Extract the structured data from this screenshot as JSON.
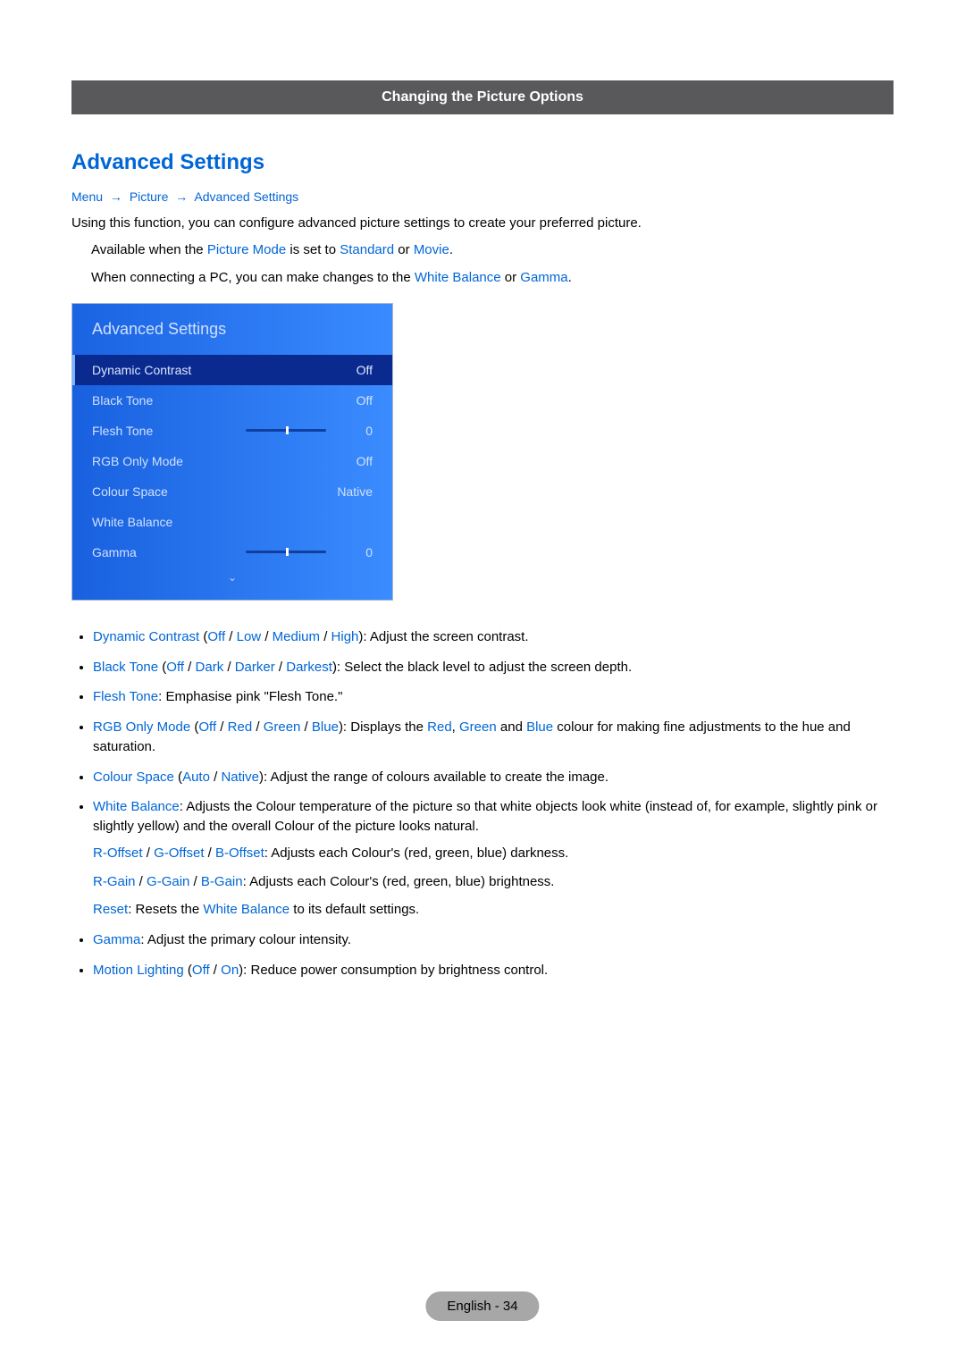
{
  "banner": "Changing the Picture Options",
  "heading": "Advanced Settings",
  "breadcrumb": {
    "a": "Menu",
    "b": "Picture",
    "c": "Advanced Settings"
  },
  "intro": "Using this function, you can configure advanced picture settings to create your preferred picture.",
  "note1_pre": "Available when the ",
  "note1_pm": "Picture Mode",
  "note1_mid": " is set to ",
  "note1_std": "Standard",
  "note1_or": " or ",
  "note1_mov": "Movie",
  "note1_end": ".",
  "note2_pre": "When connecting a PC, you can make changes to the ",
  "note2_wb": "White Balance",
  "note2_or": " or ",
  "note2_ga": "Gamma",
  "note2_end": ".",
  "panel": {
    "title": "Advanced Settings",
    "rows": {
      "r0": {
        "label": "Dynamic Contrast",
        "value": "Off"
      },
      "r1": {
        "label": "Black Tone",
        "value": "Off"
      },
      "r2": {
        "label": "Flesh Tone",
        "value": "0"
      },
      "r3": {
        "label": "RGB Only Mode",
        "value": "Off"
      },
      "r4": {
        "label": "Colour Space",
        "value": "Native"
      },
      "r5": {
        "label": "White Balance",
        "value": ""
      },
      "r6": {
        "label": "Gamma",
        "value": "0"
      }
    }
  },
  "b1": {
    "name": "Dynamic Contrast",
    "opts": {
      "o0": "Off",
      "o1": "Low",
      "o2": "Medium",
      "o3": "High"
    },
    "desc": "): Adjust the screen contrast."
  },
  "b2": {
    "name": "Black Tone",
    "opts": {
      "o0": "Off",
      "o1": "Dark",
      "o2": "Darker",
      "o3": "Darkest"
    },
    "desc": "): Select the black level to adjust the screen depth."
  },
  "b3": {
    "name": "Flesh Tone",
    "desc": ": Emphasise pink \"Flesh Tone.\""
  },
  "b4": {
    "name": "RGB Only Mode",
    "opts": {
      "o0": "Off",
      "o1": "Red",
      "o2": "Green",
      "o3": "Blue"
    },
    "desc_pre": "): Displays the ",
    "c1": "Red",
    "c2": "Green",
    "c3": "Blue",
    "desc_post": " colour for making fine adjustments to the hue and saturation."
  },
  "b5": {
    "name": "Colour Space",
    "opts": {
      "o0": "Auto",
      "o1": "Native"
    },
    "desc": "): Adjust the range of colours available to create the image."
  },
  "b6": {
    "name": "White Balance",
    "desc": ": Adjusts the Colour temperature of the picture so that white objects look white (instead of, for example, slightly pink or slightly yellow) and the overall Colour of the picture looks natural.",
    "offsets": {
      "r": "R-Offset",
      "g": "G-Offset",
      "b": "B-Offset"
    },
    "off_desc": ": Adjusts each Colour's (red, green, blue) darkness.",
    "gains": {
      "r": "R-Gain",
      "g": "G-Gain",
      "b": "B-Gain"
    },
    "gain_desc": ": Adjusts each Colour's (red, green, blue) brightness.",
    "reset": "Reset",
    "reset_mid": ": Resets the ",
    "reset_wb": "White Balance",
    "reset_end": " to its default settings."
  },
  "b7": {
    "name": "Gamma",
    "desc": ": Adjust the primary colour intensity."
  },
  "b8": {
    "name": "Motion Lighting",
    "opts": {
      "o0": "Off",
      "o1": "On"
    },
    "desc": "): Reduce power consumption by brightness control."
  },
  "sep": " / ",
  "paren_open": " (",
  "comma": ", ",
  "and": " and ",
  "pager": "English - 34"
}
